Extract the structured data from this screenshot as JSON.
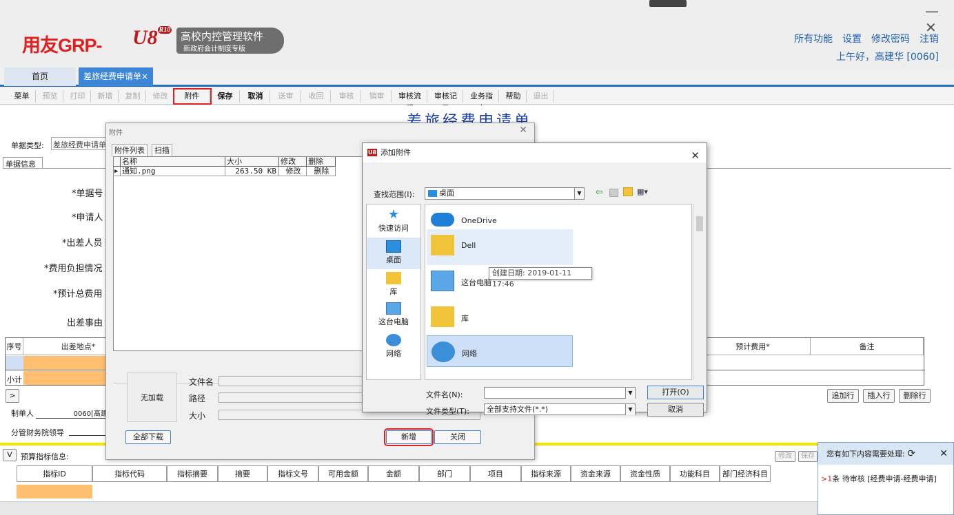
{
  "app": {
    "brand": "用友GRP-",
    "brand2": "U8",
    "brand_ver": "R10",
    "product": "高校内控管理软件",
    "edition": "新政府会计制度专版"
  },
  "window": {
    "min": "—",
    "close": "✕"
  },
  "top_links": [
    "所有功能",
    "设置",
    "修改密码",
    "注销"
  ],
  "greeting": "上午好，高建华 [0060]",
  "tabs": {
    "home": "首页",
    "current": "差旅经费申请单",
    "close": "×"
  },
  "toolbar": [
    {
      "label": "菜单 ▾",
      "enabled": true
    },
    {
      "label": "预览",
      "enabled": false
    },
    {
      "label": "打印",
      "enabled": false
    },
    {
      "label": "新增",
      "enabled": false
    },
    {
      "label": "复制",
      "enabled": false
    },
    {
      "label": "修改",
      "enabled": false
    },
    {
      "label": "附件",
      "enabled": true,
      "highlight": true
    },
    {
      "label": "保存",
      "enabled": true
    },
    {
      "label": "取消",
      "enabled": true
    },
    {
      "label": "送审",
      "enabled": false
    },
    {
      "label": "收回",
      "enabled": false
    },
    {
      "label": "审核",
      "enabled": false
    },
    {
      "label": "销审",
      "enabled": false
    },
    {
      "label": "审核流程",
      "enabled": true
    },
    {
      "label": "审核记录",
      "enabled": true
    },
    {
      "label": "业务指南",
      "enabled": true
    },
    {
      "label": "帮助",
      "enabled": true
    },
    {
      "label": "退出",
      "enabled": false
    }
  ],
  "form": {
    "title": "差旅经费申请单",
    "doc_type_label": "单据类型:",
    "doc_type_value": "差旅经费申请单",
    "section_tab": "单据信息",
    "fields": [
      "*单据号",
      "*申请人",
      "*出差人员",
      "*费用负担情况",
      "*预计总费用",
      "出差事由"
    ]
  },
  "grid": {
    "headers": [
      "序号",
      "出差地点*",
      "预计费用*",
      "备注"
    ],
    "subtotal": "小计",
    "expand": ">",
    "buttons": [
      "追加行",
      "插入行",
      "删除行"
    ]
  },
  "signers": {
    "maker_label": "制单人",
    "maker_value": "0060[高建",
    "leader_label": "分管财务院领导"
  },
  "budget": {
    "toggle": "V",
    "label": "预算指标信息:",
    "buttons": [
      "修改",
      "保存"
    ],
    "headers": [
      "指标ID",
      "指标代码",
      "指标摘要",
      "摘要",
      "指标文号",
      "可用金额",
      "金额",
      "部门",
      "项目",
      "指标来源",
      "资金来源",
      "资金性质",
      "功能科目",
      "部门经济科目"
    ]
  },
  "notify": {
    "title": "您有如下内容需要处理:",
    "item_prefix": ">",
    "item_count": "1",
    "item_text": "条 待审核 [经费申请-经费申请]"
  },
  "attach_dialog": {
    "title": "附件",
    "close": "✕",
    "tabs": [
      "附件列表",
      "扫描"
    ],
    "columns": [
      "名称",
      "大小",
      "修改",
      "删除"
    ],
    "row": {
      "name": "通知.png",
      "size": "263.50 KB",
      "edit": "修改",
      "del": "删除"
    },
    "preview": "无加载",
    "file_name_label": "文件名",
    "path_label": "路径",
    "size_label": "大小",
    "download_all": "全部下载",
    "add": "新增",
    "close_btn": "关闭"
  },
  "open_dialog": {
    "title": "添加附件",
    "look_in_label": "查找范围(I):",
    "look_in_value": "桌面",
    "places": [
      "快速访问",
      "桌面",
      "库",
      "这台电脑",
      "网络"
    ],
    "items": [
      "OneDrive",
      "Dell",
      "这台电脑",
      "库",
      "网络"
    ],
    "tooltip": "创建日期: 2019-01-11 17:46",
    "file_name_label": "文件名(N):",
    "file_name_value": "",
    "file_type_label": "文件类型(T):",
    "file_type_value": "全部支持文件(*.*)",
    "open_btn": "打开(O)",
    "cancel_btn": "取消"
  },
  "colors": {
    "accent": "#1f6fbf",
    "highlight": "#e02020",
    "orange": "#ffbe70"
  }
}
